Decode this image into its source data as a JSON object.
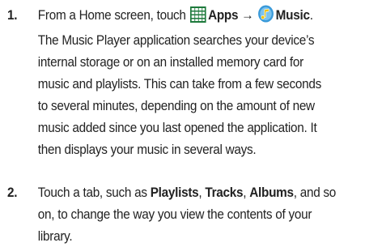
{
  "steps": [
    {
      "number": "1.",
      "intro": "From a Home screen, touch",
      "apps_label": "Apps",
      "arrow": "→",
      "music_label": "Music",
      "period": ".",
      "lines": [
        "The Music Player application searches your device’s",
        "internal storage or on an installed memory card for",
        "music and playlists. This can take from a few seconds",
        "to several minutes, depending on the amount of new",
        "music added since you last opened the application. It",
        "then displays your music in several ways."
      ]
    },
    {
      "number": "2.",
      "prefix": "Touch a tab, such as",
      "tab_playlists": "Playlists",
      "sep1": ",",
      "tab_tracks": "Tracks",
      "sep2": ",",
      "tab_albums": "Albums",
      "suffix": ", and so",
      "lines": [
        "on, to change the way you view the contents of your",
        "library."
      ]
    }
  ],
  "icons": {
    "apps": "apps-grid-icon",
    "music": "music-note-icon",
    "apps_color": "#1e7a3c",
    "music_circle_color": "#3a9ad9",
    "music_note_color": "#f2c200"
  }
}
